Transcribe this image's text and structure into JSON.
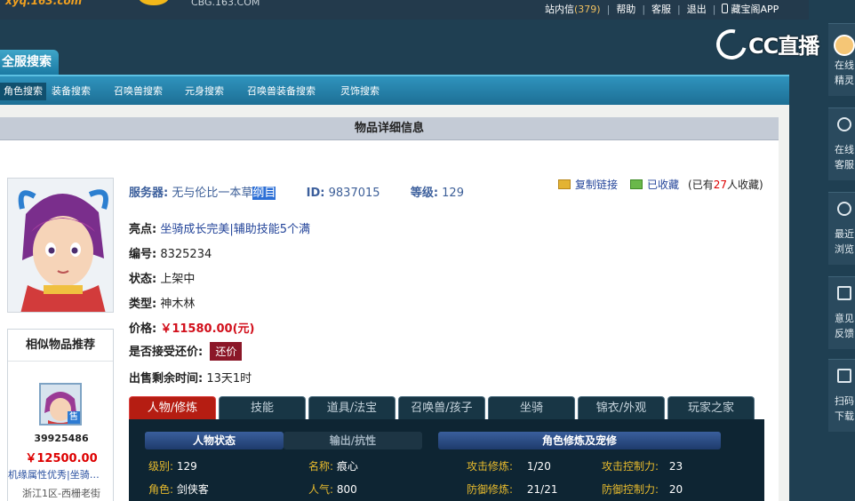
{
  "topbar": {
    "logo": "xyq.163.com",
    "domain": "CBG.163.COM",
    "links": [
      {
        "label": "站内信",
        "count": "(379)"
      },
      {
        "label": "帮助"
      },
      {
        "label": "客服"
      },
      {
        "label": "退出"
      },
      {
        "label": "藏宝阁APP"
      }
    ]
  },
  "watermark": "CC直播",
  "dock": [
    {
      "line1": "在线",
      "line2": "精灵"
    },
    {
      "line1": "在线",
      "line2": "客服"
    },
    {
      "line1": "最近",
      "line2": "浏览"
    },
    {
      "line1": "意见",
      "line2": "反馈"
    },
    {
      "line1": "扫码",
      "line2": "下载"
    }
  ],
  "search": {
    "title": "全服搜索",
    "tabs": [
      "角色搜索",
      "装备搜索",
      "召唤兽搜索",
      "元身搜索",
      "召唤兽装备搜索",
      "灵饰搜索"
    ]
  },
  "panel": {
    "title": "物品详细信息",
    "server_label": "服务器:",
    "server_value_a": "无与伦比一本草",
    "server_value_sel": "纲目",
    "id_label": "ID:",
    "id_value": "9837015",
    "level_label": "等级:",
    "level_value": "129",
    "copy_link": "复制链接",
    "favorited": "已收藏",
    "fav_count_prefix": "(已有",
    "fav_count_n": "27",
    "fav_count_suffix": "人收藏)",
    "highlight_label": "亮点:",
    "highlight_value": "坐骑成长完美|辅助技能5个满",
    "number_label": "编号:",
    "number_value": "8325234",
    "status_label": "状态:",
    "status_value": "上架中",
    "type_label": "类型:",
    "type_value": "神木林",
    "price_label": "价格:",
    "price_value": "￥11580.00(元)",
    "bargain_label": "是否接受还价:",
    "bargain_btn": "还价",
    "remain_label": "出售剩余时间:",
    "remain_value": "13天1时"
  },
  "similar": {
    "title": "相似物品推荐",
    "badge": "售",
    "id": "39925486",
    "price": "￥12500.00",
    "desc": "机缘属性优秀|坐骑…",
    "server": "浙江1区-西栅老街"
  },
  "detail_tabs": [
    "人物/修炼",
    "技能",
    "道具/法宝",
    "召唤兽/孩子",
    "坐骑",
    "锦衣/外观",
    "玩家之家"
  ],
  "detail": {
    "sec_a": "人物状态",
    "sec_b": "输出/抗性",
    "sec_c": "角色修炼及宠修",
    "rows": [
      {
        "k1": "级别:",
        "v1": "129",
        "k2": "名称:",
        "v2": "痕心",
        "k3": "攻击修炼:",
        "v3": "1/20",
        "k4": "攻击控制力:",
        "v4": "23"
      },
      {
        "k1": "角色:",
        "v1": "剑侠客",
        "k2": "人气:",
        "v2": "800",
        "k3": "防御修炼:",
        "v3": "21/21",
        "k4": "防御控制力:",
        "v4": "20"
      }
    ]
  }
}
